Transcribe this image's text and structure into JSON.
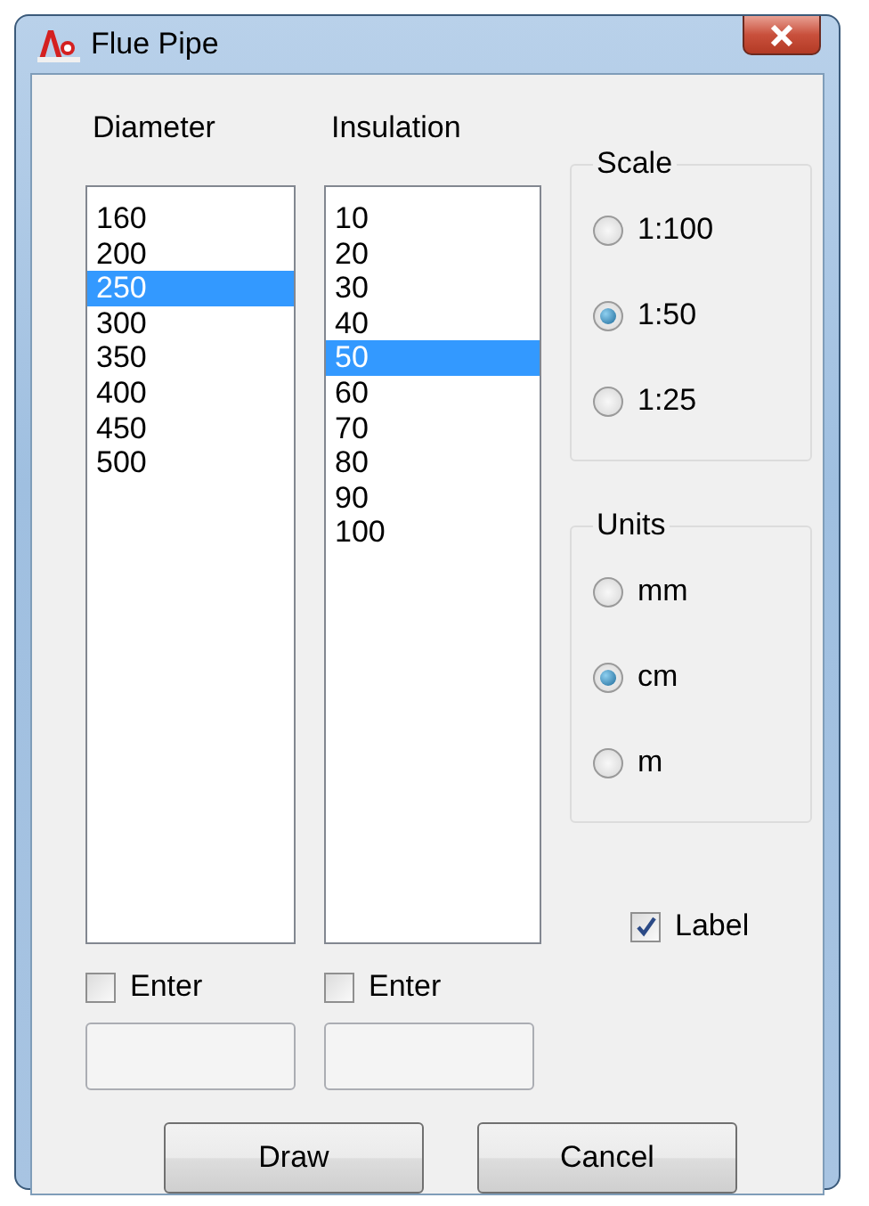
{
  "window": {
    "title": "Flue Pipe"
  },
  "lists": [
    {
      "heading": "Diameter",
      "items": [
        {
          "label": "160",
          "selected": false
        },
        {
          "label": "200",
          "selected": false
        },
        {
          "label": "250",
          "selected": true
        },
        {
          "label": "300",
          "selected": false
        },
        {
          "label": "350",
          "selected": false
        },
        {
          "label": "400",
          "selected": false
        },
        {
          "label": "450",
          "selected": false
        },
        {
          "label": "500",
          "selected": false
        }
      ],
      "enter": {
        "label": "Enter",
        "checked": false
      }
    },
    {
      "heading": "Insulation",
      "items": [
        {
          "label": "10",
          "selected": false
        },
        {
          "label": "20",
          "selected": false
        },
        {
          "label": "30",
          "selected": false
        },
        {
          "label": "40",
          "selected": false
        },
        {
          "label": "50",
          "selected": true
        },
        {
          "label": "60",
          "selected": false
        },
        {
          "label": "70",
          "selected": false
        },
        {
          "label": "80",
          "selected": false
        },
        {
          "label": "90",
          "selected": false
        },
        {
          "label": "100",
          "selected": false
        }
      ],
      "enter": {
        "label": "Enter",
        "checked": false
      }
    }
  ],
  "groups": [
    {
      "title": "Scale",
      "options": [
        {
          "label": "1:100",
          "selected": false
        },
        {
          "label": "1:50",
          "selected": true
        },
        {
          "label": "1:25",
          "selected": false
        }
      ]
    },
    {
      "title": "Units",
      "options": [
        {
          "label": "mm",
          "selected": false
        },
        {
          "label": "cm",
          "selected": true
        },
        {
          "label": "m",
          "selected": false
        }
      ]
    }
  ],
  "label_option": {
    "label": "Label",
    "checked": true
  },
  "buttons": [
    "Draw",
    "Cancel"
  ]
}
